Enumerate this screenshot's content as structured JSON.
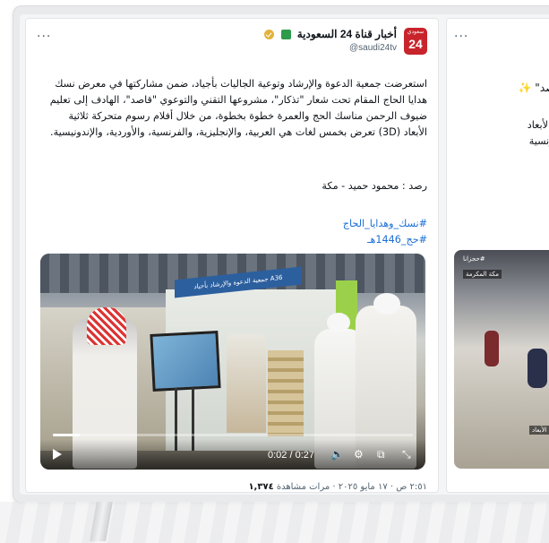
{
  "tweet": {
    "avatar": {
      "small_text": "سعودي",
      "number": "24"
    },
    "account_name": "أخبار قناة 24 السعودية",
    "handle": "@saudi24tv",
    "more": "···",
    "body": "استعرضت جمعية الدعوة والإرشاد وتوعية الجاليات بأجياد، ضمن مشاركتها في معرض نسك هدايا الحاج المقام تحت شعار \"تذكار\"، مشروعها التقني والتوعوي \"قاصد\"، الهادف إلى تعليم ضيوف الرحمن مناسك الحج والعمرة خطوة بخطوة، من خلال أفلام رسوم متحركة ثلاثية الأبعاد (3D) تعرض بخمس لغات هي العربية، والإنجليزية، والفرنسية، والأوردية، والإندونيسية.",
    "monitor": "رصد : محمود حميد - مكة",
    "hashtags": [
      "#نسك_وهدايا_الحاج",
      "#حج_1446هـ"
    ],
    "video": {
      "booth_banner": "جمعية الدعوة والإرشاد بأجياد A36",
      "time": "0:02 / 0:27",
      "progress": 0.074
    },
    "meta": {
      "time_date": "٢:٥١ ص · ١٧ مايو ٢٠٢٥ ·",
      "views_label": "مرات مشاهدة",
      "views_count": "١,٣٧٤"
    }
  },
  "tweet2": {
    "more": "···",
    "line1": "وع \"قاصد\"",
    "line2": "ثلاثية الأبعاد",
    "line3": "رية والفرنسية",
    "video_tag1": "#حجزانا",
    "video_tag2": "مكة المكرمة",
    "video_tag3": "ثة الأبعاد"
  },
  "icons": [
    "play-icon",
    "volume-icon",
    "gear-icon",
    "pip-icon",
    "fullscreen-icon",
    "more-icon",
    "verified-icon",
    "flag-icon"
  ]
}
